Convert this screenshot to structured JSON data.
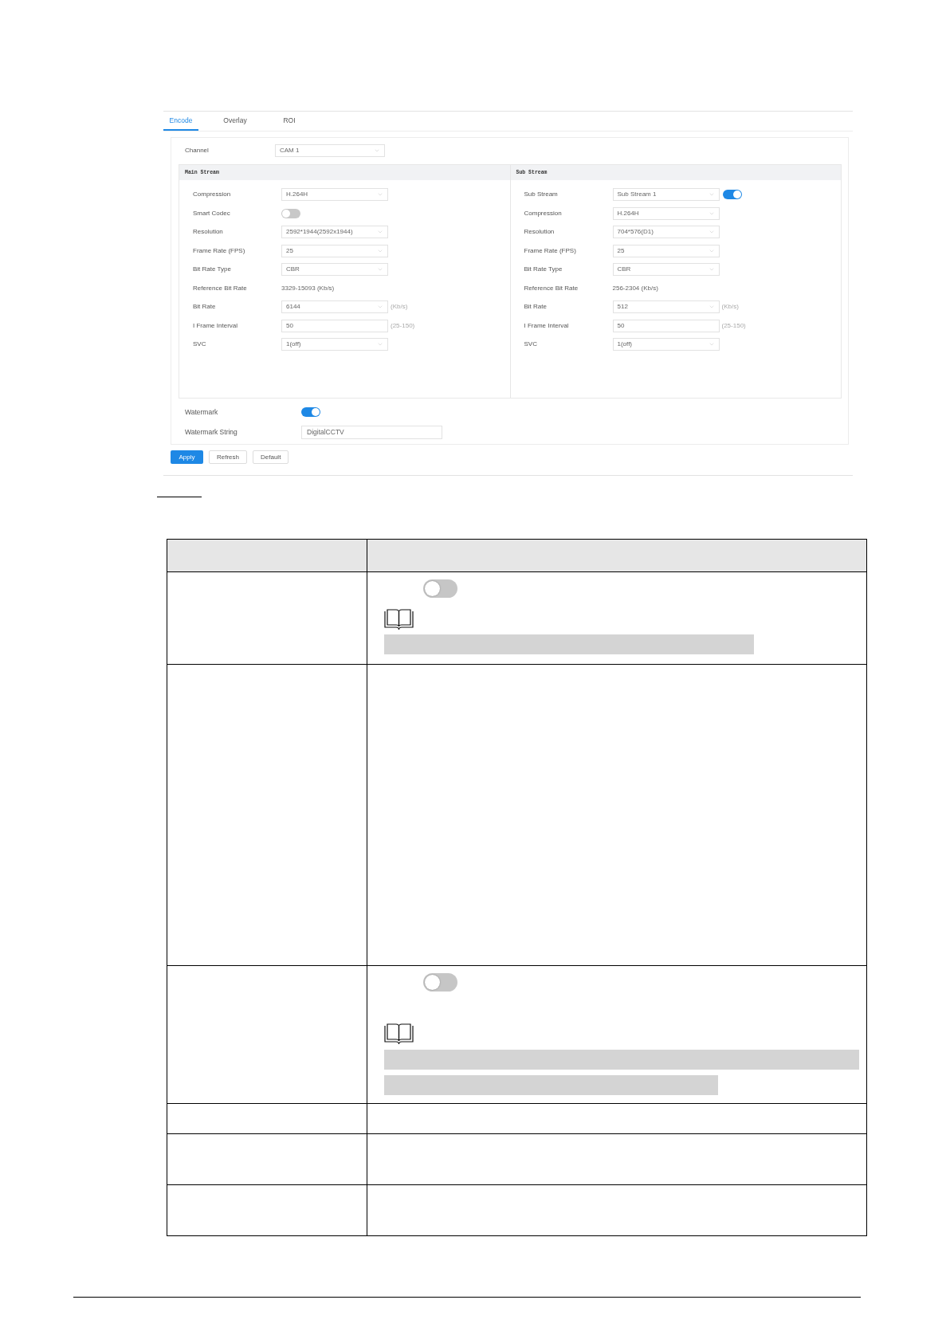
{
  "settings": {
    "tabs": [
      {
        "label": "Encode",
        "selected": true
      },
      {
        "label": "Overlay",
        "selected": false
      },
      {
        "label": "ROI",
        "selected": false
      }
    ],
    "channel": {
      "label": "Channel",
      "value": "CAM 1"
    },
    "streams": [
      {
        "title": "Main Stream",
        "fields": [
          {
            "kind": "select",
            "label": "Compression",
            "value": "H.264H"
          },
          {
            "kind": "toggle",
            "label": "Smart Codec",
            "on": false
          },
          {
            "kind": "select",
            "label": "Resolution",
            "value": "2592*1944(2592x1944)"
          },
          {
            "kind": "select",
            "label": "Frame Rate (FPS)",
            "value": "25"
          },
          {
            "kind": "select",
            "label": "Bit Rate Type",
            "value": "CBR"
          },
          {
            "kind": "text",
            "label": "Reference Bit Rate",
            "value": "3329-15093 (Kb/s)"
          },
          {
            "kind": "select",
            "label": "Bit Rate",
            "value": "6144",
            "suffix": "(Kb/s)"
          },
          {
            "kind": "input",
            "label": "I Frame Interval",
            "value": "50",
            "suffix": "(25-150)"
          },
          {
            "kind": "select",
            "label": "SVC",
            "value": "1(off)"
          }
        ]
      },
      {
        "title": "Sub Stream",
        "fields": [
          {
            "kind": "select_toggle",
            "label": "Sub Stream",
            "value": "Sub Stream 1",
            "on": true
          },
          {
            "kind": "select",
            "label": "Compression",
            "value": "H.264H"
          },
          {
            "kind": "select",
            "label": "Resolution",
            "value": "704*576(D1)"
          },
          {
            "kind": "select",
            "label": "Frame Rate (FPS)",
            "value": "25"
          },
          {
            "kind": "select",
            "label": "Bit Rate Type",
            "value": "CBR"
          },
          {
            "kind": "text",
            "label": "Reference Bit Rate",
            "value": "256-2304 (Kb/s)"
          },
          {
            "kind": "select",
            "label": "Bit Rate",
            "value": "512",
            "suffix": "(Kb/s)"
          },
          {
            "kind": "input",
            "label": "I Frame Interval",
            "value": "50",
            "suffix": "(25-150)"
          },
          {
            "kind": "select",
            "label": "SVC",
            "value": "1(off)"
          }
        ]
      }
    ],
    "watermark": {
      "label": "Watermark",
      "on": true
    },
    "watermark_string": {
      "label": "Watermark String",
      "value": "DigitalCCTV"
    },
    "buttons": [
      {
        "label": "Apply",
        "primary": true
      },
      {
        "label": "Refresh",
        "primary": false
      },
      {
        "label": "Default",
        "primary": false
      }
    ]
  },
  "table": {
    "rows": [
      {
        "kind": "toggle_note",
        "on": false,
        "note_lines": [
          {
            "kind": "long"
          }
        ]
      },
      {
        "kind": "empty_block"
      },
      {
        "kind": "toggle_line_note",
        "on": false,
        "note_lines": [
          {
            "kind": "full"
          },
          {
            "kind": "short"
          }
        ]
      },
      {
        "kind": "empty_line"
      },
      {
        "kind": "empty_two_lines"
      },
      {
        "kind": "empty_two_lines"
      }
    ]
  }
}
